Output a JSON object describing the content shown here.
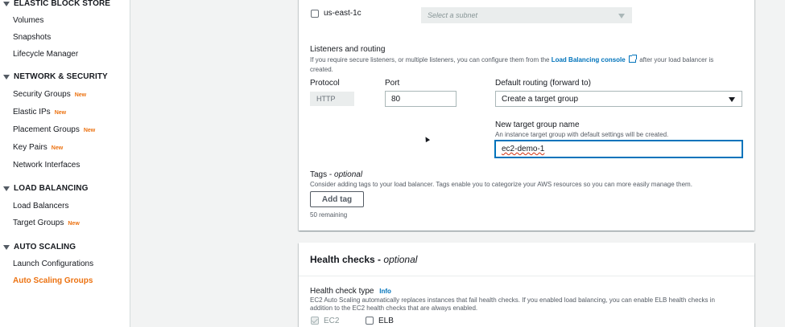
{
  "sidebar": {
    "sections": [
      {
        "title": "ELASTIC BLOCK STORE"
      },
      {
        "title": "NETWORK & SECURITY"
      },
      {
        "title": "LOAD BALANCING"
      },
      {
        "title": "AUTO SCALING"
      }
    ],
    "items": [
      {
        "label": "Volumes",
        "badge": ""
      },
      {
        "label": "Snapshots",
        "badge": ""
      },
      {
        "label": "Lifecycle Manager",
        "badge": ""
      },
      {
        "label": "Security Groups",
        "badge": "New"
      },
      {
        "label": "Elastic IPs",
        "badge": "New"
      },
      {
        "label": "Placement Groups",
        "badge": "New"
      },
      {
        "label": "Key Pairs",
        "badge": "New"
      },
      {
        "label": "Network Interfaces",
        "badge": ""
      },
      {
        "label": "Load Balancers",
        "badge": ""
      },
      {
        "label": "Target Groups",
        "badge": "New"
      },
      {
        "label": "Launch Configurations",
        "badge": ""
      },
      {
        "label": "Auto Scaling Groups",
        "badge": "",
        "active": true
      }
    ]
  },
  "az": {
    "label": "us-east-1c",
    "subnet_placeholder": "Select a subnet"
  },
  "listeners": {
    "title": "Listeners and routing",
    "desc_prefix": "If you require secure listeners, or multiple listeners, you can configure them from the",
    "desc_link": "Load Balancing console",
    "desc_suffix": "after your load balancer is",
    "desc_line2": "created.",
    "protocol_label": "Protocol",
    "protocol_value": "HTTP",
    "port_label": "Port",
    "port_value": "80",
    "routing_label": "Default routing (forward to)",
    "routing_value": "Create a target group",
    "tg_name_label": "New target group name",
    "tg_name_desc": "An instance target group with default settings will be created.",
    "tg_name_value": "ec2-demo-1"
  },
  "tags": {
    "title": "Tags",
    "optional": "optional",
    "desc": "Consider adding tags to your load balancer. Tags enable you to categorize your AWS resources so you can more easily manage them.",
    "add_button": "Add tag",
    "remaining": "50 remaining"
  },
  "health": {
    "title": "Health checks",
    "optional": "optional",
    "type_label": "Health check type",
    "info": "Info",
    "desc_line1": "EC2 Auto Scaling automatically replaces instances that fail health checks. If you enabled load balancing, you can enable ELB health checks in",
    "desc_line2": "addition to the EC2 health checks that are always enabled.",
    "ec2_label": "EC2",
    "elb_label": "ELB"
  },
  "colors": {
    "accent_orange": "#ec7211",
    "link_blue": "#0073bb",
    "focus_blue": "#0073bb"
  }
}
